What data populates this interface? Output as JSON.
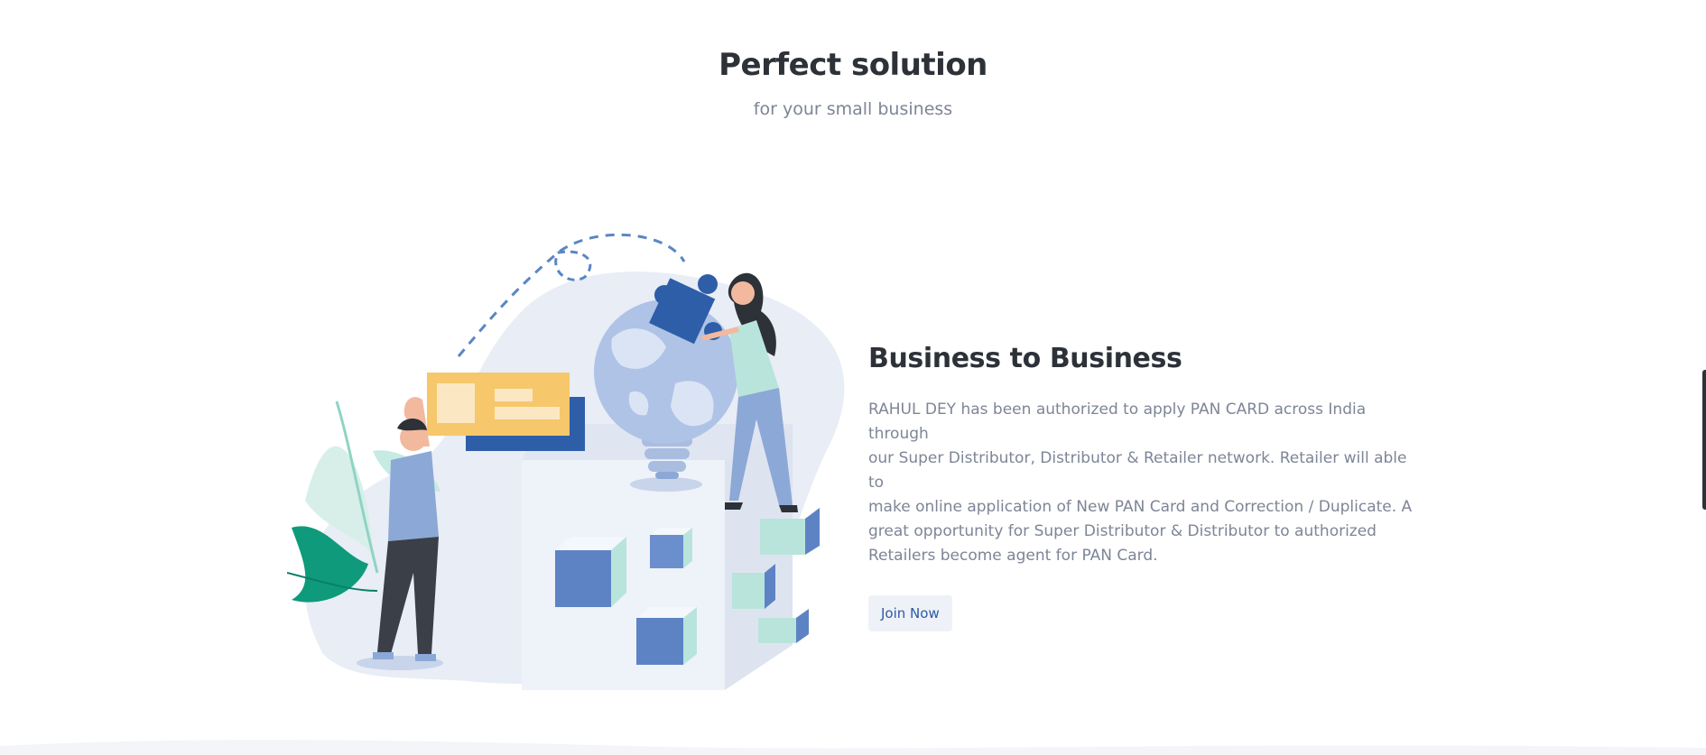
{
  "section": {
    "title": "Perfect solution",
    "subtitle": "for your small business"
  },
  "feature": {
    "title": "Business to Business",
    "description": "RAHUL DEY has been authorized to apply PAN CARD across India through\nour Super Distributor, Distributor & Retailer network. Retailer will able to\nmake online application of New PAN Card and Correction / Duplicate. A\ngreat opportunity for Super Distributor & Distributor to authorized\nRetailers become agent for PAN Card.",
    "button_label": "Join Now"
  },
  "illustration": {
    "name": "business-collaboration-illustration",
    "palette": {
      "navy": "#2f5ea8",
      "light_blue": "#8ca8d6",
      "pale_blue": "#e8edf6",
      "mint": "#b9e4db",
      "yellow": "#f6c76b",
      "green": "#0e9a7b",
      "dark": "#2d3138"
    }
  },
  "colors": {
    "heading": "#2d3138",
    "body_text": "#7d8596",
    "accent": "#2b5aa8",
    "button_bg": "#eef1f7"
  }
}
